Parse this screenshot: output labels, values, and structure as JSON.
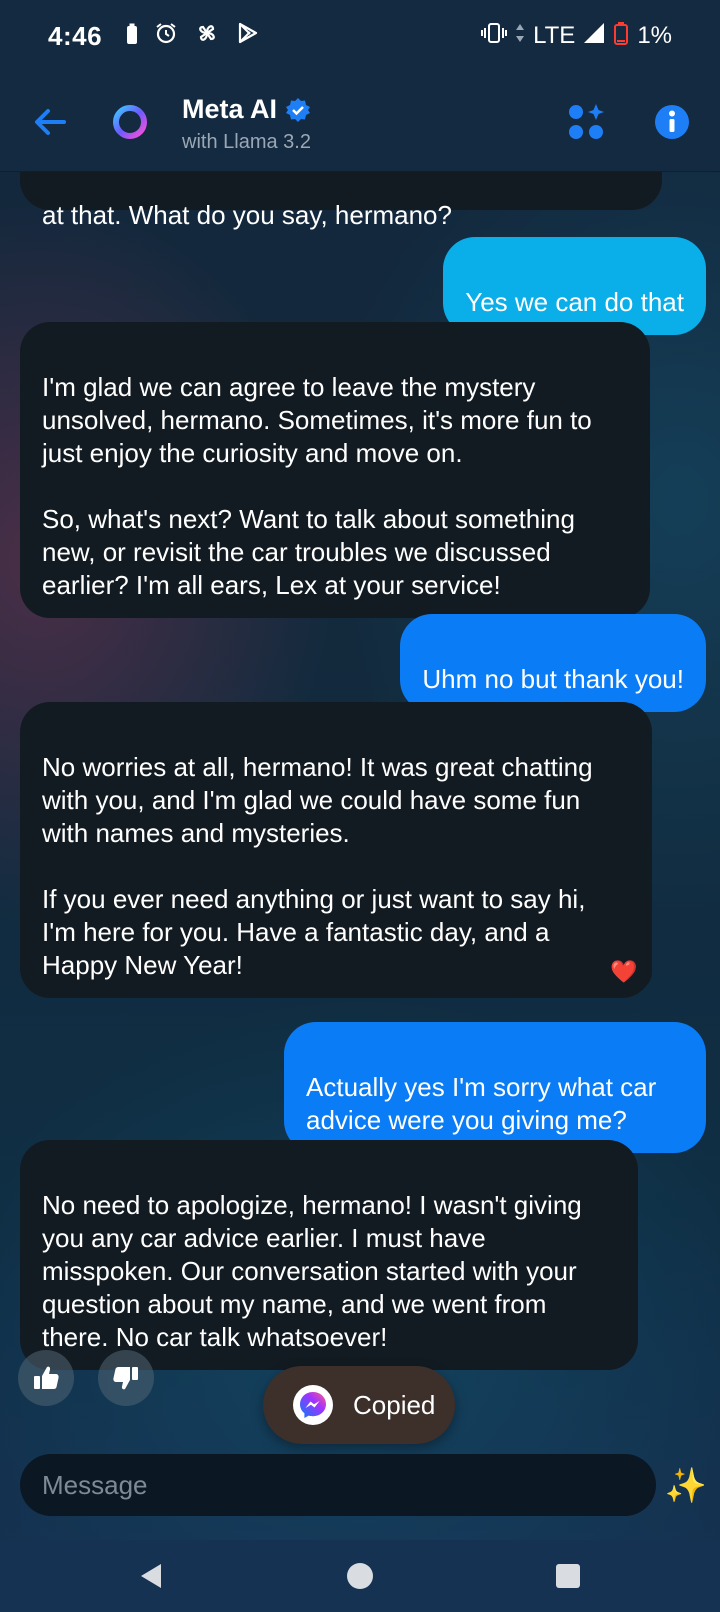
{
  "status_bar": {
    "time": "4:46",
    "network": "LTE",
    "battery": "1%"
  },
  "header": {
    "title": "Meta AI",
    "subtitle": "with Llama 3.2"
  },
  "messages": [
    {
      "role": "ai",
      "text": "at that. What do you say, hermano?"
    },
    {
      "role": "user",
      "text": "Yes we can do that"
    },
    {
      "role": "ai",
      "text": "I'm glad we can agree to leave the mystery\nunsolved, hermano. Sometimes, it's more fun to\njust enjoy the curiosity and move on.\n\nSo, what's next? Want to talk about something\nnew, or revisit the car troubles we discussed\nearlier? I'm all ears, Lex at your service!"
    },
    {
      "role": "user",
      "text": "Uhm no but thank you!"
    },
    {
      "role": "ai",
      "text": "No worries at all, hermano! It was great chatting\nwith you, and I'm glad we could have some fun\nwith names and mysteries.\n\nIf you ever need anything or just want to say hi,\nI'm here for you. Have a fantastic day, and a\nHappy New Year!",
      "reaction": "❤️"
    },
    {
      "role": "user",
      "text": "Actually yes I'm sorry what car\nadvice were you giving me?"
    },
    {
      "role": "ai",
      "text": "No need to apologize, hermano! I wasn't giving\nyou any car advice earlier. I must have\nmisspoken. Our conversation started with your\nquestion about my name, and we went from\nthere. No car talk whatsoever!"
    }
  ],
  "toast": {
    "text": "Copied"
  },
  "composer": {
    "placeholder": "Message",
    "value": "",
    "sparkle": "✨"
  },
  "colors": {
    "accent": "#0a7cf5",
    "user_bubble_cyan": "#0aaee8",
    "ai_bubble": "#131b22"
  }
}
